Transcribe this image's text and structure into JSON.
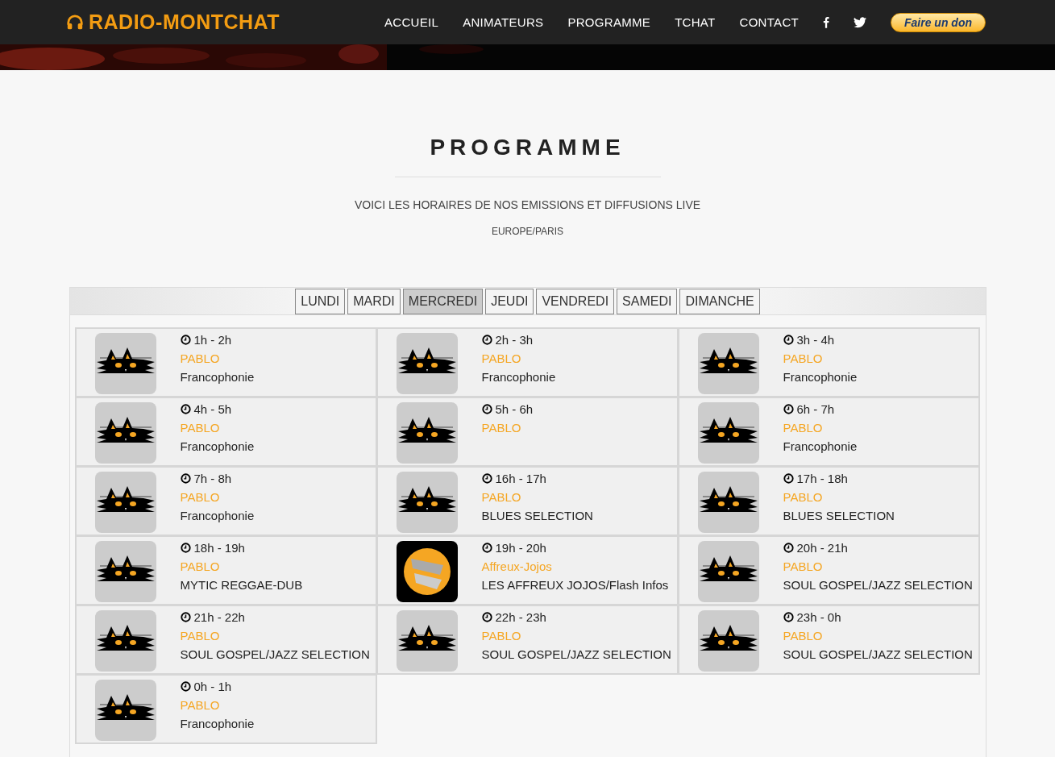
{
  "site": {
    "logo": "RADIO-MONTCHAT",
    "nav": [
      "ACCUEIL",
      "ANIMATEURS",
      "PROGRAMME",
      "TCHAT",
      "CONTACT"
    ],
    "donate": "Faire un don"
  },
  "heading": {
    "title": "PROGRAMME",
    "subtitle": "VOICI LES HORAIRES DE NOS EMISSIONS ET DIFFUSIONS LIVE",
    "timezone": "EUROPE/PARIS"
  },
  "days": [
    {
      "label": "LUNDI",
      "selected": false
    },
    {
      "label": "MARDI",
      "selected": false
    },
    {
      "label": "MERCREDI",
      "selected": true
    },
    {
      "label": "JEUDI",
      "selected": false
    },
    {
      "label": "VENDREDI",
      "selected": false
    },
    {
      "label": "SAMEDI",
      "selected": false
    },
    {
      "label": "DIMANCHE",
      "selected": false
    }
  ],
  "shows": [
    {
      "kind": "cat",
      "time": "1h - 2h",
      "host": "PABLO",
      "title": "Francophonie"
    },
    {
      "kind": "cat",
      "time": "2h - 3h",
      "host": "PABLO",
      "title": "Francophonie"
    },
    {
      "kind": "cat",
      "time": "3h - 4h",
      "host": "PABLO",
      "title": "Francophonie"
    },
    {
      "kind": "cat",
      "time": "4h - 5h",
      "host": "PABLO",
      "title": "Francophonie"
    },
    {
      "kind": "cat",
      "time": "5h - 6h",
      "host": "PABLO"
    },
    {
      "kind": "cat",
      "time": "6h - 7h",
      "host": "PABLO",
      "title": "Francophonie"
    },
    {
      "kind": "cat",
      "time": "7h - 8h",
      "host": "PABLO",
      "title": "Francophonie"
    },
    {
      "kind": "cat",
      "time": "16h - 17h",
      "host": "PABLO",
      "title": "BLUES SELECTION"
    },
    {
      "kind": "cat",
      "time": "17h - 18h",
      "host": "PABLO",
      "title": "BLUES SELECTION"
    },
    {
      "kind": "cat",
      "time": "18h - 19h",
      "host": "PABLO",
      "title": "MYTIC REGGAE-DUB"
    },
    {
      "kind": "badge",
      "time": "19h - 20h",
      "host": "Affreux-Jojos",
      "title": "LES AFFREUX JOJOS/Flash Infos"
    },
    {
      "kind": "cat",
      "time": "20h - 21h",
      "host": "PABLO",
      "title": "SOUL GOSPEL/JAZZ SELECTION"
    },
    {
      "kind": "cat",
      "time": "21h - 22h",
      "host": "PABLO",
      "title": "SOUL GOSPEL/JAZZ SELECTION"
    },
    {
      "kind": "cat",
      "time": "22h - 23h",
      "host": "PABLO",
      "title": "SOUL GOSPEL/JAZZ SELECTION"
    },
    {
      "kind": "cat",
      "time": "23h - 0h",
      "host": "PABLO",
      "title": "SOUL GOSPEL/JAZZ SELECTION"
    },
    {
      "kind": "cat",
      "time": "0h - 1h",
      "host": "PABLO",
      "title": "Francophonie"
    }
  ]
}
